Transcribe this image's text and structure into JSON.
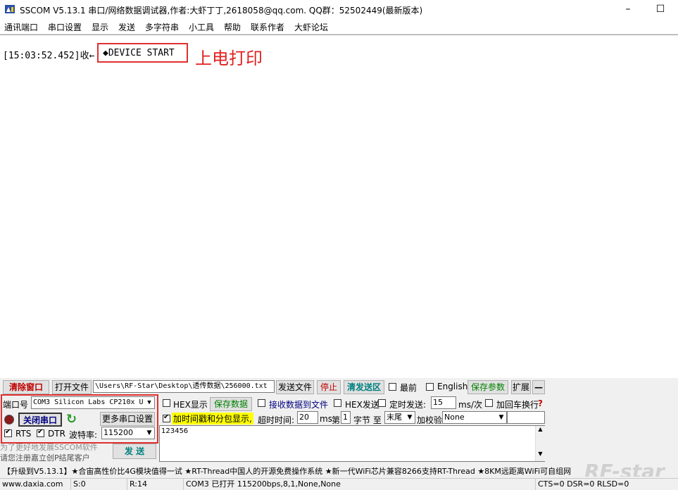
{
  "window": {
    "title": "SSCOM V5.13.1 串口/网络数据调试器,作者:大虾丁丁,2618058@qq.com. QQ群：52502449(最新版本)",
    "minimize": "–",
    "maximize": "☐"
  },
  "menu": [
    "通讯端口",
    "串口设置",
    "显示",
    "发送",
    "多字符串",
    "小工具",
    "帮助",
    "联系作者",
    "大虾论坛"
  ],
  "receive": {
    "timestamp": "[15:03:52.452]",
    "direction": "收←",
    "data": "◆DEVICE START",
    "annotation": "上电打印"
  },
  "toolbar": {
    "clear_window": "清除窗口",
    "open_file": "打开文件",
    "file_path": "\\Users\\RF-Star\\Desktop\\透传数据\\256000.txt",
    "send_file": "发送文件",
    "stop": "停止",
    "clear_send": "清发送区",
    "topmost": "最前",
    "english": "English",
    "save_params": "保存参数",
    "expand": "扩展",
    "collapse": "—"
  },
  "port": {
    "label": "端口号",
    "value": "COM3 Silicon Labs CP210x U",
    "close_button": "关闭串口",
    "more_settings": "更多串口设置",
    "rts": "RTS",
    "dtr": "DTR",
    "baud_label": "波特率:",
    "baud_value": "115200"
  },
  "options": {
    "hex_display": "HEX显示",
    "save_data": "保存数据",
    "recv_to_file": "接收数据到文件",
    "hex_send": "HEX发送",
    "timed_send": "定时发送:",
    "timed_ms": "15",
    "ms_unit": "ms/次",
    "add_crlf": "加回车换行",
    "timestamp_packet": "加时间戳和分包显示,",
    "timeout_label": "超时时间:",
    "timeout_value": "20",
    "ms": "ms",
    "nth_label": "第",
    "nth_value": "1",
    "byte_to": "字节 至",
    "end_value": "末尾",
    "checksum_label": "加校验",
    "checksum_value": "None"
  },
  "send": {
    "text": "123456",
    "button": "发 送"
  },
  "promo": {
    "line1": "为了更好地发展SSCOM软件",
    "line2": "请您注册嘉立创P结尾客户"
  },
  "ticker": "【升级到V5.13.1】★合宙高性价比4G模块值得一试 ★RT-Thread中国人的开源免费操作系统 ★新一代WiFi芯片兼容8266支持RT-Thread ★8KM远距离WiFi可自组网",
  "watermark": "RF-star",
  "status": {
    "website": "www.daxia.com",
    "sent": "S:0",
    "received": "R:14",
    "port_state": "COM3 已打开  115200bps,8,1,None,None",
    "signals": "CTS=0 DSR=0 RLSD=0"
  }
}
